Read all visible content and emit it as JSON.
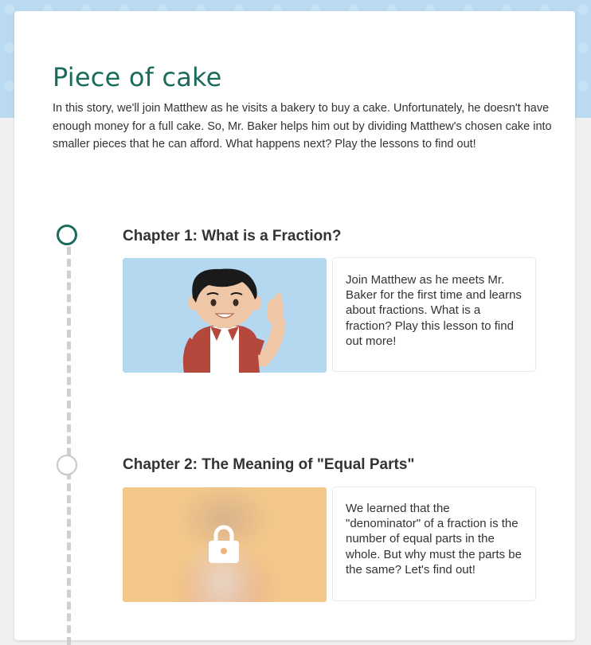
{
  "story": {
    "title": "Piece of cake",
    "description": "In this story, we'll join Matthew as he visits a bakery to buy a cake. Unfortunately, he doesn't have enough money for a full cake. So, Mr. Baker helps him out by dividing Matthew's chosen cake into smaller pieces that he can afford. What happens next? Play the lessons to find out!"
  },
  "chapters": [
    {
      "title": "Chapter 1: What is a Fraction?",
      "description": "Join Matthew as he meets Mr. Baker for the first time and learns about fractions. What is a fraction? Play this lesson to find out more!",
      "status": "unlocked",
      "thumbnail_icon": "boy-waving-illustration"
    },
    {
      "title": "Chapter 2: The Meaning of \"Equal Parts\"",
      "description": "We learned that the \"denominator\" of a fraction is the number of equal parts in the whole. But why must the parts be the same? Let's find out!",
      "status": "locked",
      "thumbnail_icon": "lock-icon"
    }
  ],
  "colors": {
    "title_green": "#1b6b5d",
    "header_band": "#b9daf0",
    "chapter1_thumb_bg": "#b3d8ef",
    "chapter2_thumb_bg": "#f3c88a",
    "timeline_dash": "#cfcfcf"
  }
}
